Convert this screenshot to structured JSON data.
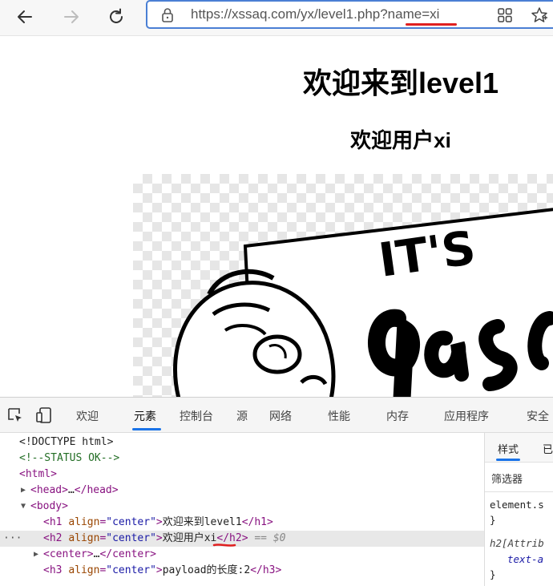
{
  "browser": {
    "url": "https://xssaq.com/yx/level1.php?name=xi"
  },
  "page": {
    "h1": "欢迎来到level1",
    "h2": "欢迎用户xi",
    "image_text_top": "IT'S"
  },
  "devtools": {
    "tabs": [
      "欢迎",
      "元素",
      "控制台",
      "源",
      "网络",
      "性能",
      "内存",
      "应用程序",
      "安全"
    ],
    "active_tab": "元素",
    "dom": {
      "doctype": "<!DOCTYPE html>",
      "comment": "<!--STATUS OK-->",
      "html_open": "<html>",
      "head": {
        "open": "<head>",
        "ellipsis": "…",
        "close": "</head>"
      },
      "body_open": "<body>",
      "h1": {
        "tag": "h1",
        "attr": "align",
        "value": "\"center\"",
        "text": "欢迎来到level1",
        "close": "</h1>"
      },
      "h2": {
        "tag": "h2",
        "attr": "align",
        "value": "\"center\"",
        "text": "欢迎用户xi",
        "close": "</h2>",
        "selected_marker": "== $0"
      },
      "center": {
        "open": "<center>",
        "ellipsis": "…",
        "close": "</center>"
      },
      "h3": {
        "tag": "h3",
        "attr": "align",
        "value": "\"center\"",
        "text": "payload的长度:2",
        "close": "</h3>"
      },
      "row_dots": "···"
    },
    "side": {
      "tabs": [
        "样式",
        "已"
      ],
      "filter_label": "筛选器",
      "rule_selector": "element.s",
      "rule_close": "}",
      "attr_rule": "h2[Attrib",
      "attr_prop": "text-a",
      "attr_close": "}"
    }
  },
  "colors": {
    "address_border": "#4a7fd4",
    "url_mark": "#e02020",
    "tab_accent": "#1a73e8"
  }
}
